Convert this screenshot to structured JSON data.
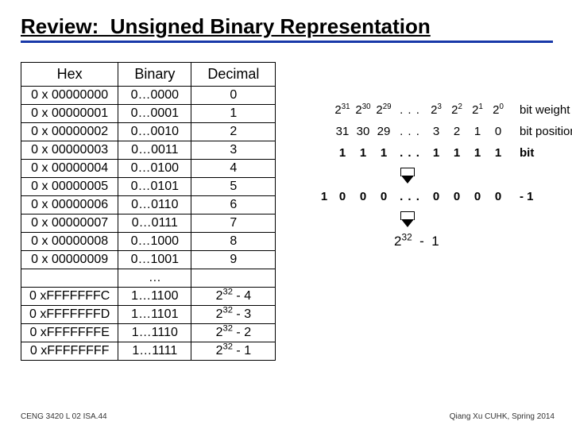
{
  "title": "Review:  Unsigned Binary Representation",
  "table": {
    "headers": [
      "Hex",
      "Binary",
      "Decimal"
    ],
    "rows": [
      {
        "hex": "0 x 00000000",
        "bin": "0…0000",
        "dec": "0"
      },
      {
        "hex": "0 x 00000001",
        "bin": "0…0001",
        "dec": "1"
      },
      {
        "hex": "0 x 00000002",
        "bin": "0…0010",
        "dec": "2"
      },
      {
        "hex": "0 x 00000003",
        "bin": "0…0011",
        "dec": "3"
      },
      {
        "hex": "0 x 00000004",
        "bin": "0…0100",
        "dec": "4"
      },
      {
        "hex": "0 x 00000005",
        "bin": "0…0101",
        "dec": "5"
      },
      {
        "hex": "0 x 00000006",
        "bin": "0…0110",
        "dec": "6"
      },
      {
        "hex": "0 x 00000007",
        "bin": "0…0111",
        "dec": "7"
      },
      {
        "hex": "0 x 00000008",
        "bin": "0…1000",
        "dec": "8"
      },
      {
        "hex": "0 x 00000009",
        "bin": "0…1001",
        "dec": "9"
      },
      {
        "hex": "",
        "bin": "…",
        "dec": ""
      },
      {
        "hex": "0 x.FFFFFFFC",
        "bin": "1…1100",
        "dec": "2^32 - 4"
      },
      {
        "hex": "0 x.FFFFFFFD",
        "bin": "1…1101",
        "dec": "2^32 - 3"
      },
      {
        "hex": "0 x.FFFFFFFE",
        "bin": "1…1110",
        "dec": "2^32 - 2"
      },
      {
        "hex": "0 x.FFFFFFFF",
        "bin": "1…1111",
        "dec": "2^32 - 1"
      }
    ]
  },
  "right": {
    "weight_label": "bit weight",
    "weights_hi": [
      "31",
      "30",
      "29"
    ],
    "weights_lo": [
      "3",
      "2",
      "1",
      "0"
    ],
    "pos_label": "bit position",
    "pos_hi": [
      "31",
      "30",
      "29"
    ],
    "pos_lo": [
      "3",
      "2",
      "1",
      "0"
    ],
    "bit_label": "bit",
    "bits_hi": [
      "1",
      "1",
      "1"
    ],
    "bits_lo": [
      "1",
      "1",
      "1",
      "1"
    ],
    "subtract_lead": "1",
    "subtract_hi": [
      "0",
      "0",
      "0"
    ],
    "subtract_lo": [
      "0",
      "0",
      "0",
      "0"
    ],
    "subtract_op": "-  1",
    "dots": ". . .",
    "result": "2^32  -  1"
  },
  "footer": {
    "left": "CENG 3420 L 02 ISA.44",
    "right": "Qiang Xu   CUHK, Spring 2014"
  }
}
